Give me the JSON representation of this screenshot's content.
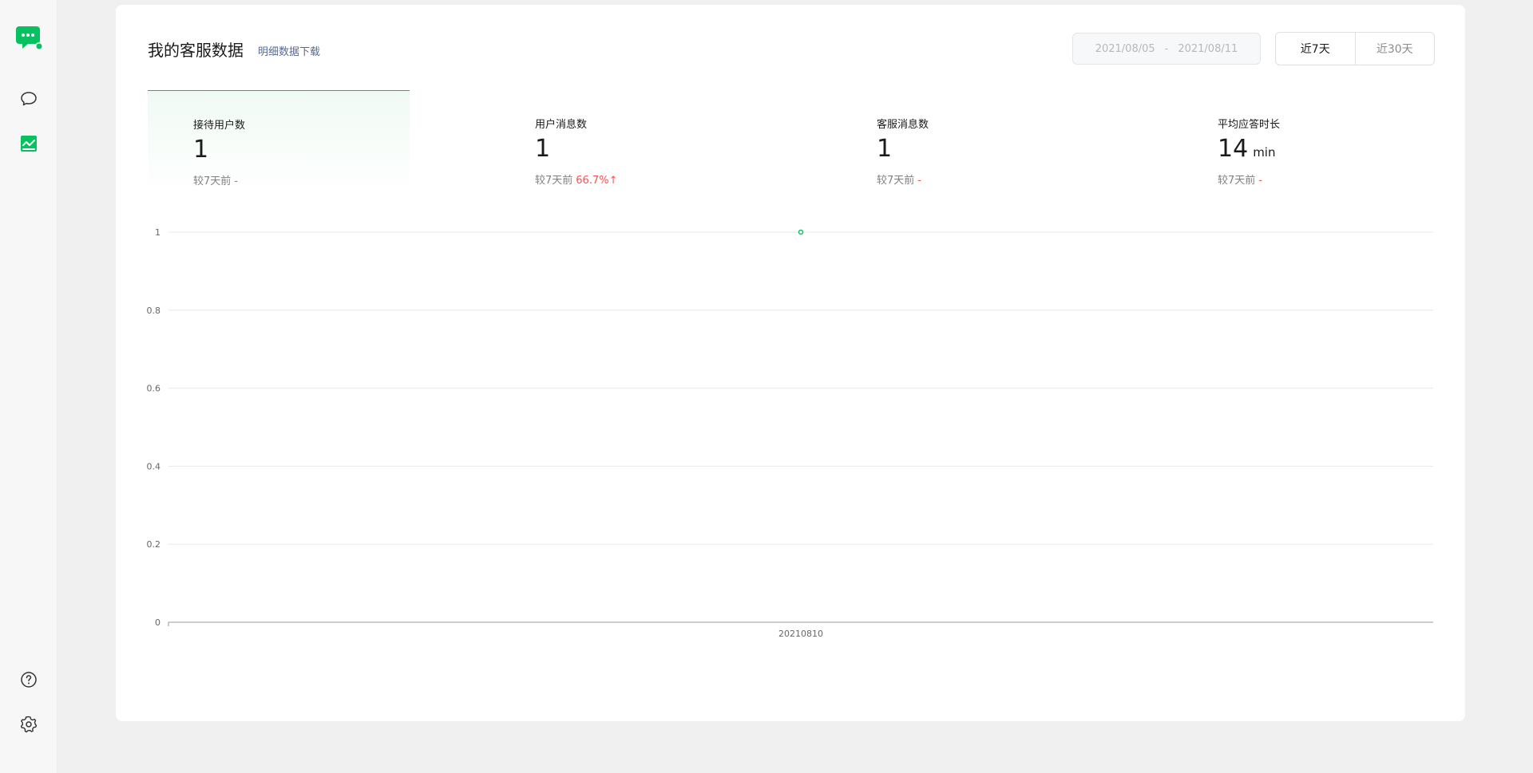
{
  "sidebar": {
    "items": [
      {
        "name": "app-logo",
        "icon": "wechat-service-icon"
      },
      {
        "name": "messages",
        "icon": "chat-bubble-icon"
      },
      {
        "name": "data",
        "icon": "chart-icon"
      },
      {
        "name": "help",
        "icon": "help-icon"
      },
      {
        "name": "settings",
        "icon": "gear-icon"
      }
    ],
    "accent": "#07c160"
  },
  "header": {
    "title": "我的客服数据",
    "download_link": "明细数据下载",
    "date_range": {
      "start": "2021/08/05",
      "separator": "-",
      "end": "2021/08/11"
    },
    "range_tabs": [
      {
        "label": "近7天",
        "active": true
      },
      {
        "label": "近30天",
        "active": false
      }
    ]
  },
  "stats": [
    {
      "label": "接待用户数",
      "value": "1",
      "unit": "",
      "compare_label": "较7天前",
      "change": "-",
      "active": true
    },
    {
      "label": "用户消息数",
      "value": "1",
      "unit": "",
      "compare_label": "较7天前",
      "change": "66.7%↑",
      "active": false
    },
    {
      "label": "客服消息数",
      "value": "1",
      "unit": "",
      "compare_label": "较7天前",
      "change": "-",
      "active": false
    },
    {
      "label": "平均应答时长",
      "value": "14",
      "unit": "min",
      "compare_label": "较7天前",
      "change": "-",
      "active": false
    }
  ],
  "chart_data": {
    "type": "line",
    "categories": [
      "20210810"
    ],
    "series": [
      {
        "values": [
          1
        ],
        "color": "#07c160"
      }
    ],
    "yticks": [
      "1",
      "0.8",
      "0.6",
      "0.4",
      "0.2",
      "0"
    ],
    "ylim": [
      0,
      1
    ],
    "grid": true
  }
}
